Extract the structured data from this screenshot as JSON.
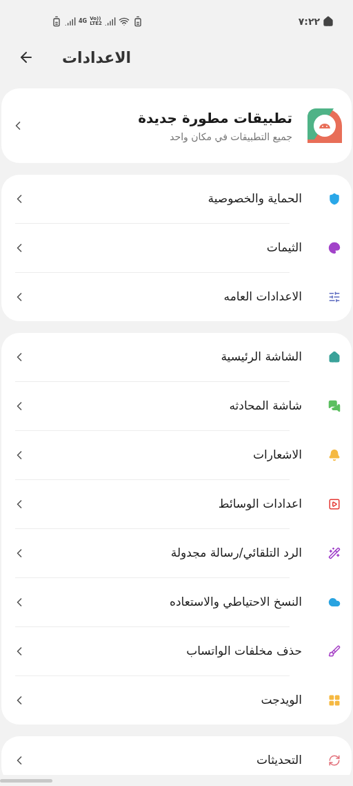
{
  "status_bar": {
    "time": "٧:٢٢",
    "network": "4G",
    "volte": "Vo))",
    "lte": "LTE2"
  },
  "header": {
    "title": "الاعدادات"
  },
  "featured": {
    "title": "تطبيقات مطورة جديدة",
    "subtitle": "جميع التطبيقات في مكان واحد"
  },
  "groups": [
    {
      "items": [
        {
          "label": "الحماية والخصوصية"
        },
        {
          "label": "الثيمات"
        },
        {
          "label": "الاعدادات العامه"
        }
      ]
    },
    {
      "items": [
        {
          "label": "الشاشة الرئيسية"
        },
        {
          "label": "شاشة المحادثه"
        },
        {
          "label": "الاشعارات"
        },
        {
          "label": "اعدادات الوسائط"
        },
        {
          "label": "الرد التلقائي/رسالة مجدولة"
        },
        {
          "label": "النسخ الاحتياطي والاستعاده"
        },
        {
          "label": "حذف مخلفات الواتساب"
        },
        {
          "label": "الويدجت"
        }
      ]
    },
    {
      "items": [
        {
          "label": "التحديثات"
        }
      ]
    }
  ]
}
